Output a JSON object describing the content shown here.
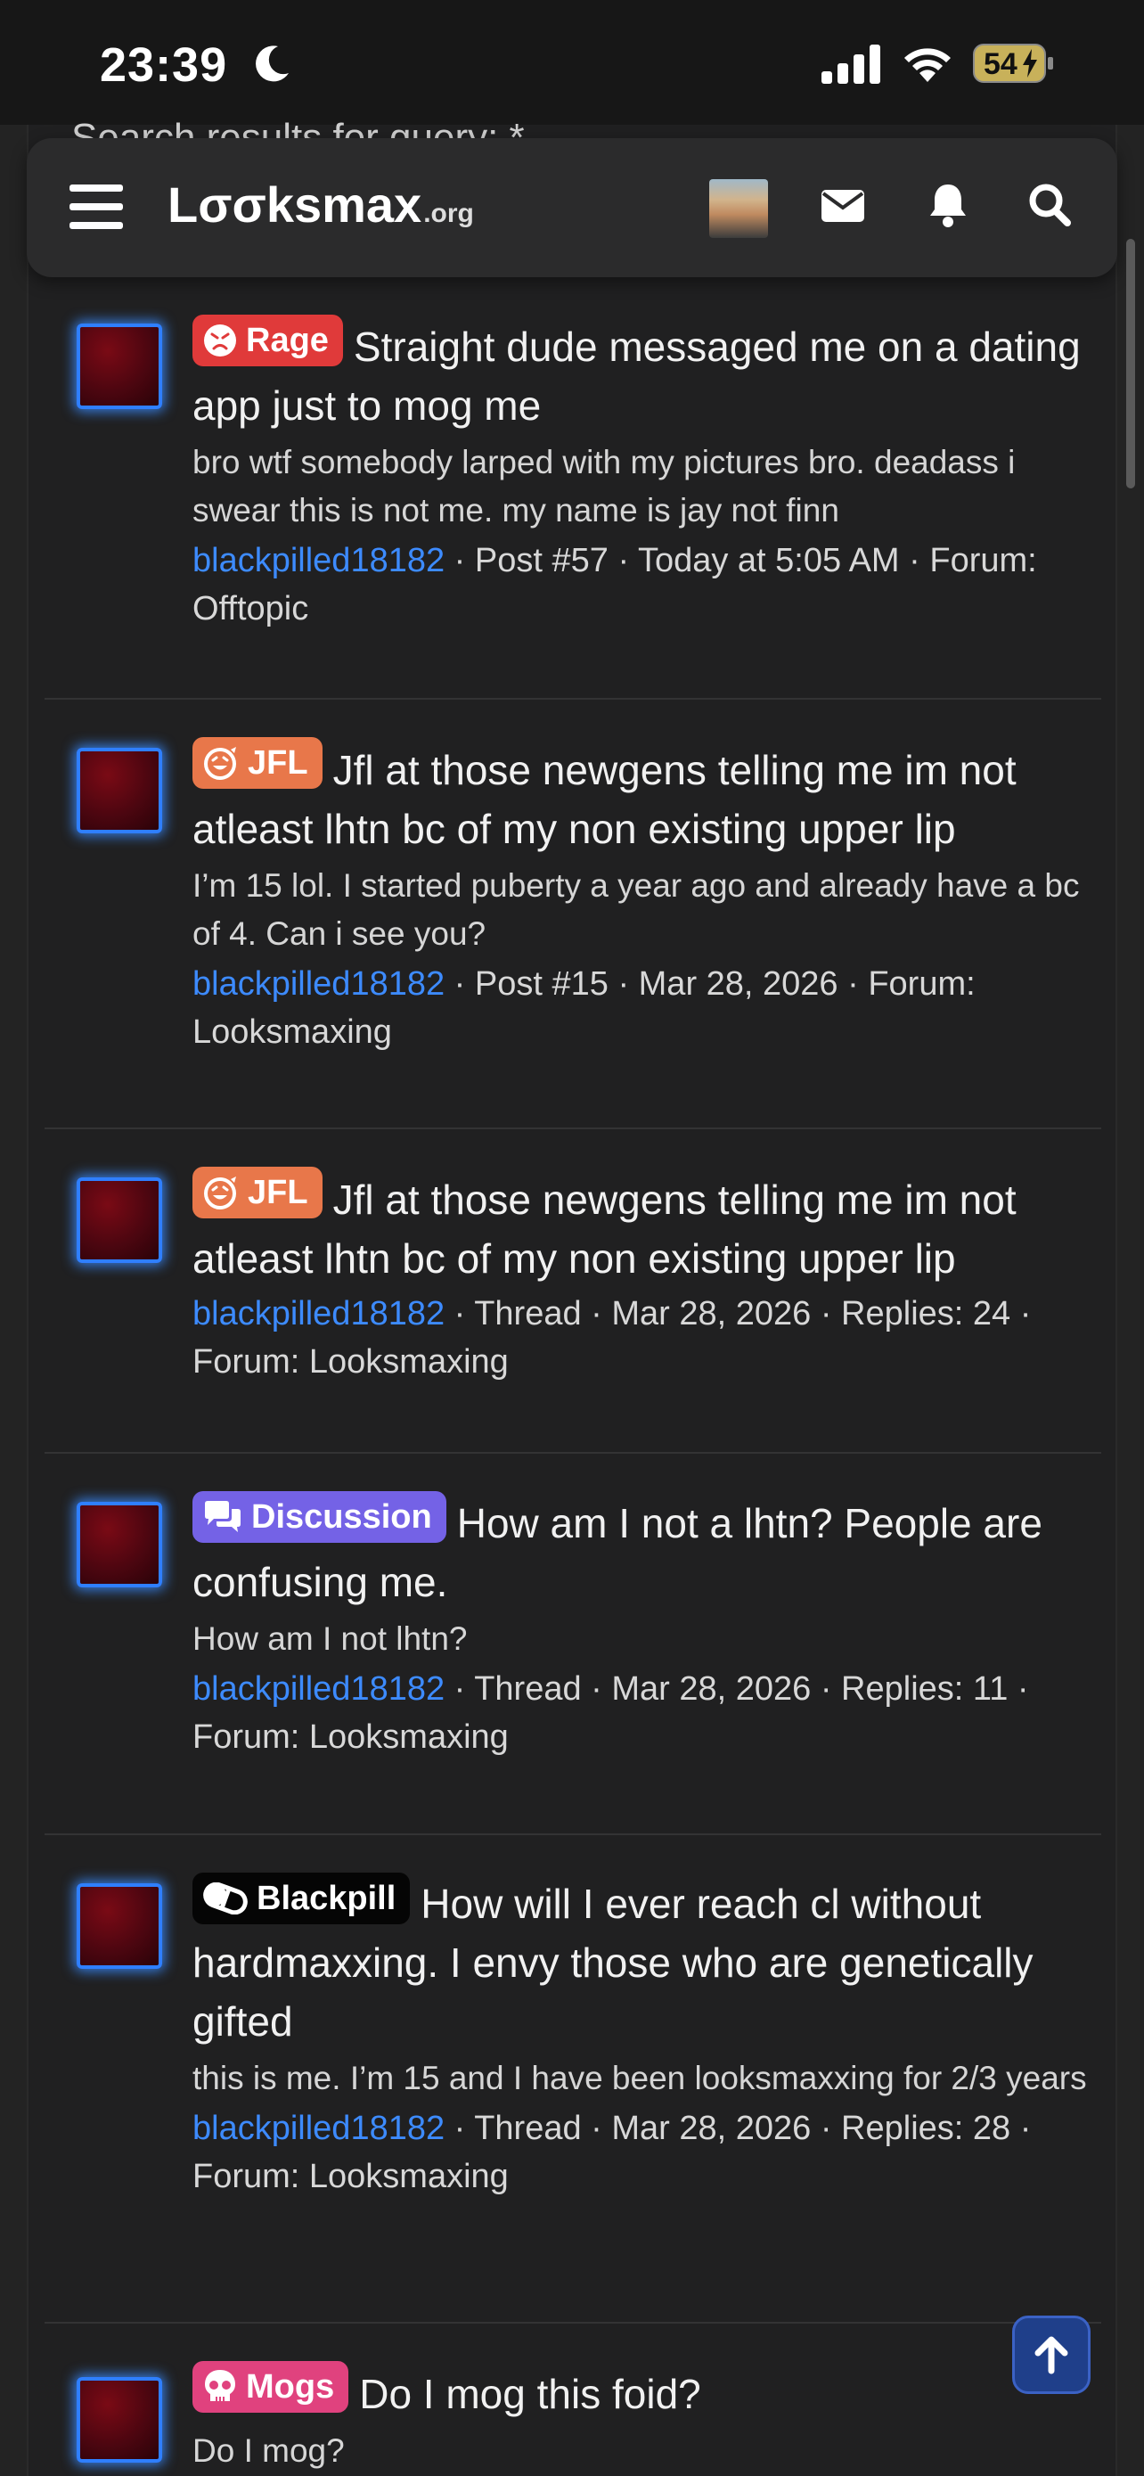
{
  "status_bar": {
    "time": "23:39",
    "battery": "54"
  },
  "behind_text": "Search results for query: *",
  "navbar": {
    "logo_main": "Lσσksmax",
    "logo_tld": ".org"
  },
  "results": [
    {
      "badge": "Rage",
      "badge_color": "#e03a3a",
      "title": "Straight dude messaged me on a dating app just to mog me",
      "snippet": "bro wtf somebody larped with my pictures bro. deadass i swear this is not me. my name is jay not finn",
      "user": "blackpilled18182",
      "meta": "· Post #57 · Today at 5:05 AM · Forum: Offtopic"
    },
    {
      "badge": "JFL",
      "badge_color": "#e8774a",
      "title": "Jfl at those newgens telling me im not atleast lhtn bc of my non existing upper lip",
      "snippet": "I’m 15 lol. I started puberty a year ago and already have a bc of 4. Can i see you?",
      "user": "blackpilled18182",
      "meta": "· Post #15 · Mar 28, 2026 · Forum: Looksmaxing"
    },
    {
      "badge": "JFL",
      "badge_color": "#e8774a",
      "title": "Jfl at those newgens telling me im not atleast lhtn bc of my non existing upper lip",
      "snippet": "",
      "user": "blackpilled18182",
      "meta": "· Thread · Mar 28, 2026 · Replies: 24 · Forum: Looksmaxing"
    },
    {
      "badge": "Discussion",
      "badge_color": "#7462e6",
      "title": "How am I not a lhtn? People are confusing me.",
      "snippet": "How am I not lhtn?",
      "user": "blackpilled18182",
      "meta": "· Thread · Mar 28, 2026 · Replies: 11 · Forum: Looksmaxing"
    },
    {
      "badge": "Blackpill",
      "badge_color": "#050505",
      "title": "How will I ever reach cl without hardmaxxing. I envy those who are genetically gifted",
      "snippet": "this is me. I’m 15 and I have been looksmaxxing for 2/3 years",
      "user": "blackpilled18182",
      "meta": "· Thread · Mar 28, 2026 · Replies: 28 · Forum: Looksmaxing"
    },
    {
      "badge": "Mogs",
      "badge_color": "#e0427e",
      "title": "Do I mog this foid?",
      "snippet": "Do I mog?",
      "user": "",
      "meta": ""
    }
  ]
}
